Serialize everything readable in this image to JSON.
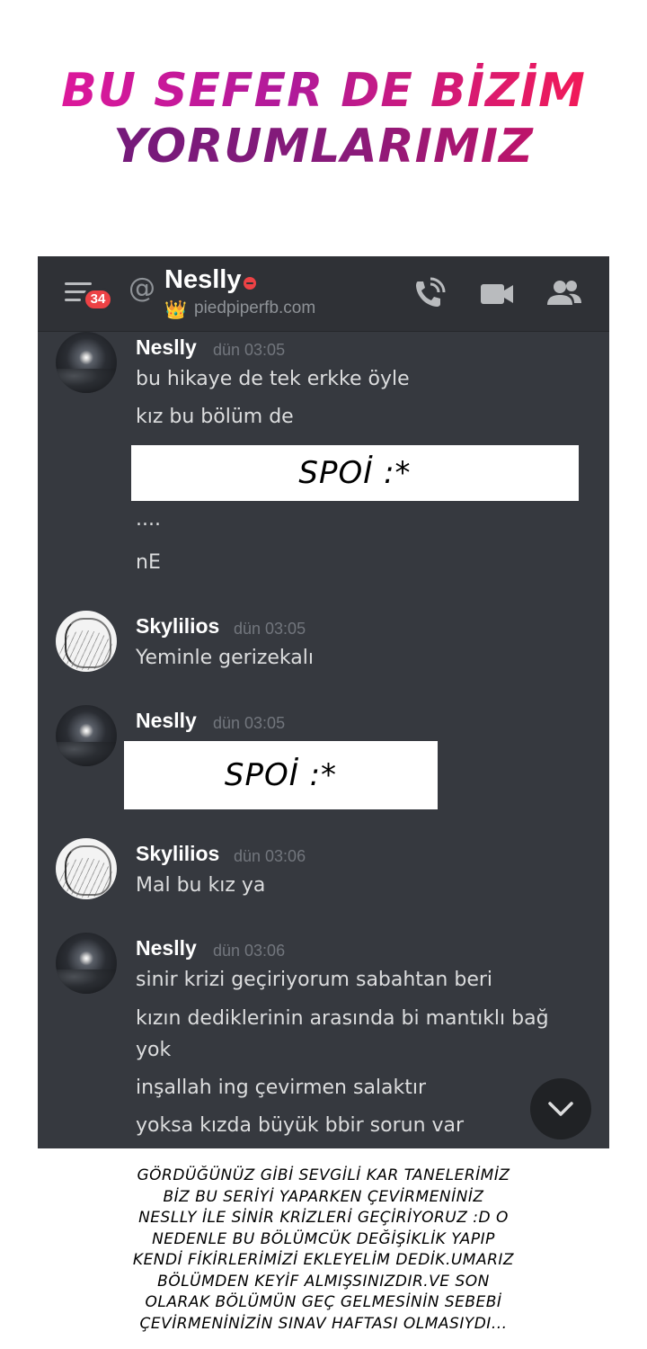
{
  "banner": {
    "line1": "BU SEFER DE BİZİM",
    "line2": "YORUMLARIMIZ"
  },
  "header": {
    "unread_count": "34",
    "at_symbol": "@",
    "dm_name": "Neslly",
    "status_emoji": "👑",
    "status_text": "piedpiperfb.com",
    "icons": [
      "menu-icon",
      "call-icon",
      "video-icon",
      "members-icon"
    ]
  },
  "messages": [
    {
      "author": "Neslly",
      "time": "dün 03:05",
      "avatar": "night-sky",
      "lines": [
        "bu hikaye de tek erkke öyle",
        "kız bu bölüm de"
      ],
      "spoiler": "SPOİ :*",
      "lines_after": [
        "....",
        "nE"
      ]
    },
    {
      "author": "Skylilios",
      "time": "dün 03:05",
      "avatar": "sketch",
      "lines": [
        "Yeminle gerizekalı"
      ]
    },
    {
      "author": "Neslly",
      "time": "dün 03:05",
      "avatar": "night-sky",
      "spoiler": "SPOİ :*"
    },
    {
      "author": "Skylilios",
      "time": "dün 03:06",
      "avatar": "sketch",
      "lines": [
        "Mal bu kız ya"
      ]
    },
    {
      "author": "Neslly",
      "time": "dün 03:06",
      "avatar": "night-sky",
      "lines": [
        "sinir krizi geçiriyorum sabahtan beri",
        "kızın dediklerinin arasında bi mantıklı bağ",
        "yok",
        "inşallah ing çevirmen salaktır",
        "yoksa kızda büyük bbir sorun var"
      ]
    }
  ],
  "caption": [
    "GÖRDÜĞÜNÜZ GİBİ SEVGİLİ KAR TANELERİMİZ",
    "BİZ BU SERİYİ YAPARKEN ÇEVİRMENİNİZ",
    "NESLLY İLE SİNİR KRİZLERİ GEÇİRİYORUZ :D O",
    "NEDENLE BU BÖLÜMCÜK DEĞİŞİKLİK YAPIP",
    "KENDİ FİKİRLERİMİZİ EKLEYELİM DEDİK.UMARIZ",
    "BÖLÜMDEN KEYİF ALMIŞSINIZDIR.VE SON",
    "OLARAK BÖLÜMÜN GEÇ GELMESİNİN SEBEBİ",
    "ÇEVİRMENİNİZİN SINAV HAFTASI OLMASIYDI..."
  ],
  "colors": {
    "app_bg": "#36393f",
    "header_bg": "#2f3136",
    "badge": "#ed4245",
    "username": "#ffffff",
    "timestamp": "#72767d",
    "message_text": "#dcddde"
  }
}
